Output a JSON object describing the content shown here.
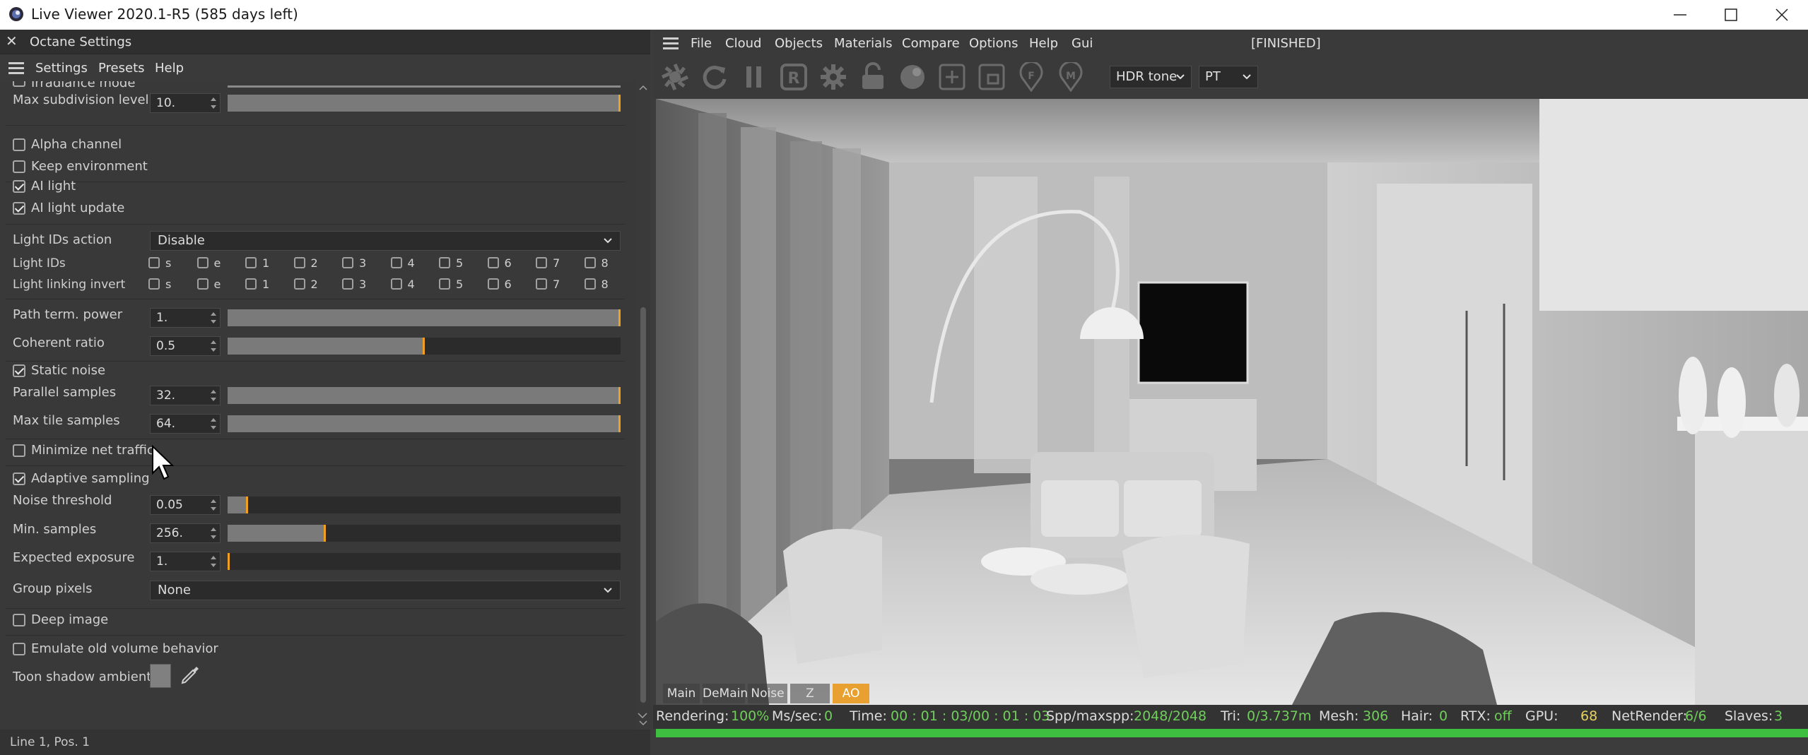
{
  "window": {
    "title": "Live Viewer 2020.1-R5 (585 days left)"
  },
  "left_panel": {
    "title": "Octane Settings",
    "menu": [
      "Settings",
      "Presets",
      "Help"
    ],
    "clipped_label": "Irradiance mode",
    "max_subdivision": {
      "label": "Max subdivision level",
      "value": "10.",
      "level": 1.0
    },
    "alpha_channel": "Alpha channel",
    "keep_environment": "Keep environment",
    "ai_light": "AI light",
    "ai_light_update": "AI light update",
    "light_ids_action": {
      "label": "Light IDs action",
      "value": "Disable"
    },
    "light_ids": "Light IDs",
    "light_linking_invert": "Light linking invert",
    "light_id_options": [
      "s",
      "e",
      "1",
      "2",
      "3",
      "4",
      "5",
      "6",
      "7",
      "8"
    ],
    "path_term_power": {
      "label": "Path term. power",
      "value": "1.",
      "level": 1.0
    },
    "coherent_ratio": {
      "label": "Coherent ratio",
      "value": "0.5",
      "level": 0.5
    },
    "static_noise": "Static noise",
    "parallel_samples": {
      "label": "Parallel samples",
      "value": "32.",
      "level": 1.0
    },
    "max_tile_samples": {
      "label": "Max tile samples",
      "value": "64.",
      "level": 1.0
    },
    "minimize_net_traffic": "Minimize net traffic",
    "adaptive_sampling": "Adaptive sampling",
    "noise_threshold": {
      "label": "Noise threshold",
      "value": "0.05",
      "level": 0.05
    },
    "min_samples": {
      "label": "Min. samples",
      "value": "256.",
      "level": 0.25
    },
    "expected_exposure": {
      "label": "Expected exposure",
      "value": "1.",
      "level": 0.0
    },
    "group_pixels": {
      "label": "Group pixels",
      "value": "None"
    },
    "deep_image": "Deep image",
    "emulate_old_volume": "Emulate old volume behavior",
    "toon_shadow_ambient": "Toon shadow ambient",
    "status": "Line 1, Pos. 1"
  },
  "viewer": {
    "menu": [
      "File",
      "Cloud",
      "Objects",
      "Materials",
      "Compare",
      "Options",
      "Help",
      "Gui"
    ],
    "state": "[FINISHED]",
    "tone_select": "HDR tone",
    "kernel_select": "PT",
    "passes": [
      "Main",
      "DeMain",
      "Noise",
      "Z",
      "AO"
    ],
    "active_pass": "AO"
  },
  "status_bar": {
    "rendering_label": "Rendering:",
    "rendering_value": "100%",
    "ms_label": "Ms/sec:",
    "ms_value": "0",
    "time_label": "Time:",
    "time_value": "00 : 01 : 03/00 : 01 : 03",
    "spp_label": "Spp/maxspp:",
    "spp_value": "2048/2048",
    "tri_label": "Tri:",
    "tri_value": "0/3.737m",
    "mesh_label": "Mesh:",
    "mesh_value": "306",
    "hair_label": "Hair:",
    "hair_value": "0",
    "rtx_label": "RTX:",
    "rtx_value": "off",
    "gpu_label": "GPU:",
    "gpu_value": "68",
    "net_label": "NetRender:",
    "net_value": "6/6",
    "slaves_label": "Slaves:",
    "slaves_value": "3"
  },
  "colors": {
    "accent": "#f0a020",
    "progress": "#3fbf3f",
    "status_value": "#6fcf5a"
  }
}
